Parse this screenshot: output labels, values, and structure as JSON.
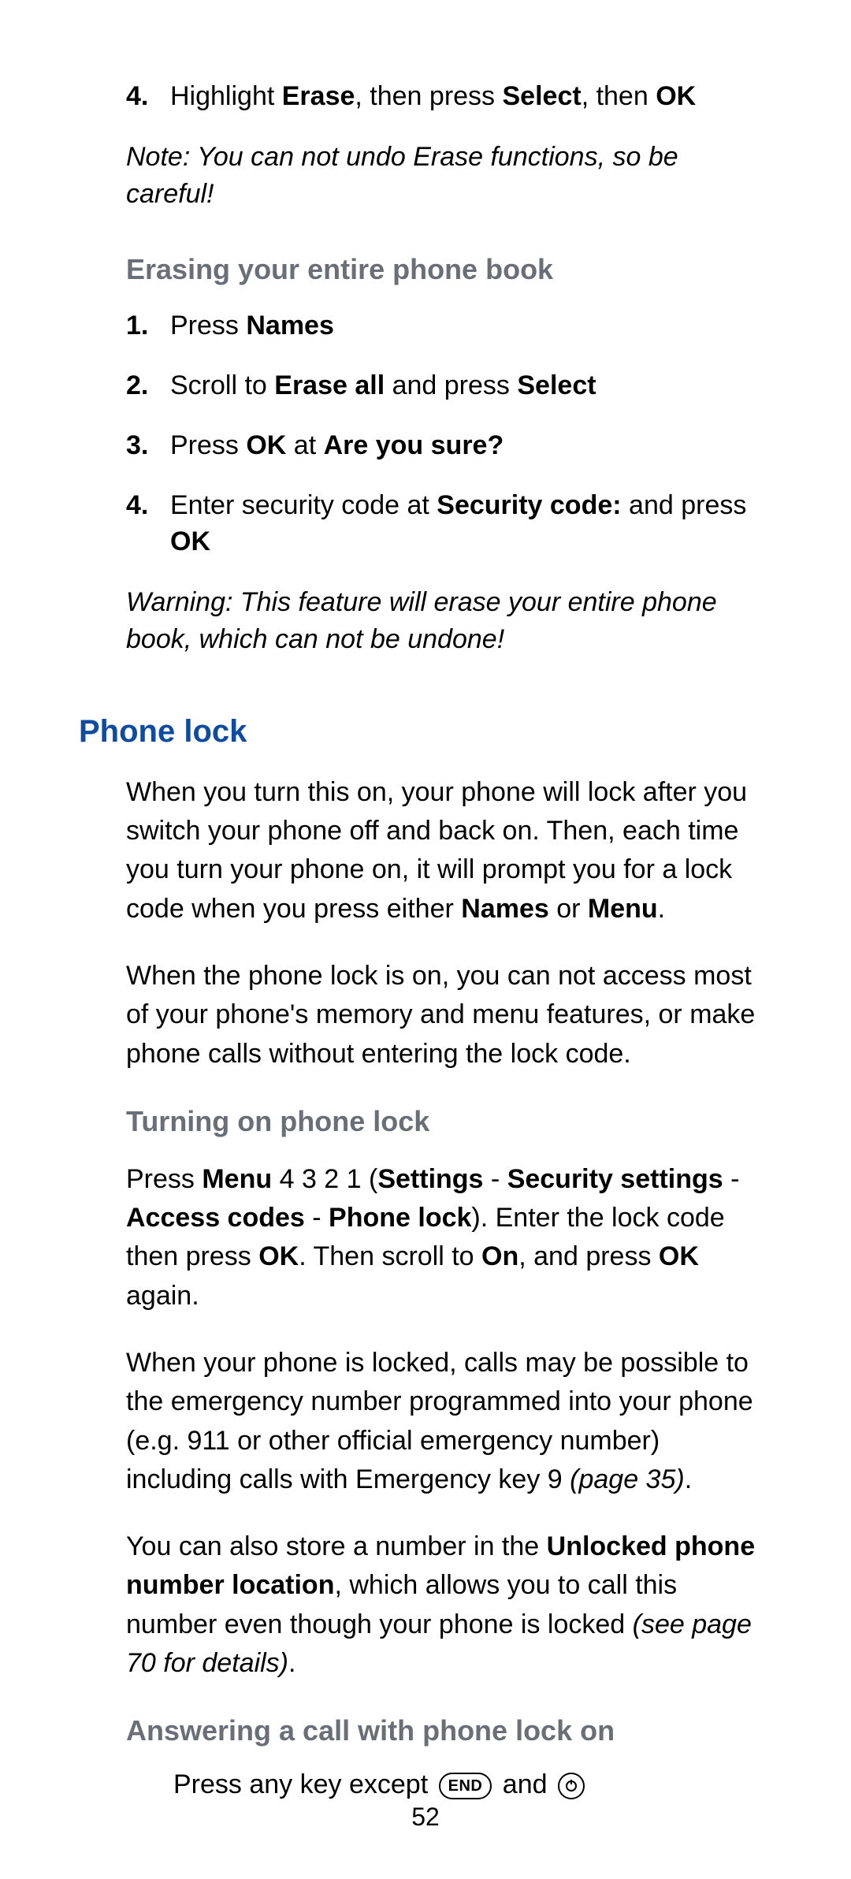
{
  "step4": {
    "num": "4.",
    "t1": "Highlight ",
    "b1": "Erase",
    "t2": ", then press ",
    "b2": "Select",
    "t3": ", then ",
    "b3": "OK"
  },
  "note1": "Note: You can not undo Erase functions, so be careful!",
  "erase": {
    "heading": "Erasing your entire phone book",
    "s1": {
      "num": "1.",
      "t1": "Press ",
      "b1": "Names"
    },
    "s2": {
      "num": "2.",
      "t1": "Scroll to ",
      "b1": "Erase all",
      "t2": " and press ",
      "b2": "Select"
    },
    "s3": {
      "num": "3.",
      "t1": "Press ",
      "b1": "OK",
      "t2": " at ",
      "b2": "Are you sure?"
    },
    "s4": {
      "num": "4.",
      "t1": "Enter security code at ",
      "b1": "Security code:",
      "t2": " and press ",
      "b2": "OK"
    },
    "warning": "Warning: This feature will erase your entire phone book, which can not be undone!"
  },
  "phonelock": {
    "heading": "Phone lock",
    "p1a": "When you turn this on, your phone will lock after you switch your phone off and back on. Then, each time you turn your phone on, it will prompt you for a lock code when you press either ",
    "p1b1": "Names",
    "p1t2": " or ",
    "p1b2": "Menu",
    "p1t3": ".",
    "p2": "When the phone lock is on, you can not access most of your phone's memory and menu features, or make phone calls without entering the lock code."
  },
  "turnon": {
    "heading": "Turning on phone lock",
    "p1": {
      "t1": "Press ",
      "b1": "Menu",
      "t2": " 4 3 2 1 (",
      "b2": "Settings",
      "t3": " - ",
      "b3": "Security settings",
      "t4": " - ",
      "b4": "Access codes",
      "t5": " - ",
      "b5": "Phone lock",
      "t6": "). Enter the lock code then press ",
      "b6": "OK",
      "t7": ". Then scroll to ",
      "b7": "On",
      "t8": ", and press ",
      "b8": "OK",
      "t9": " again."
    },
    "p2": {
      "t1": "When your phone is locked, calls may be possible to the emergency number programmed into your phone (e.g. 911 or other official emergency number) including calls with Emergency key 9 ",
      "ref": "(page 35)",
      "t2": "."
    },
    "p3": {
      "t1": "You can also store a number in the ",
      "b1": "Unlocked phone number location",
      "t2": ", which allows you to call this number even though your phone is locked ",
      "ref": "(see page 70 for details)",
      "t3": "."
    }
  },
  "answer": {
    "heading": "Answering a call with phone lock on",
    "t1": "Press any key except ",
    "key1": "END",
    "t2": " and "
  },
  "pagenum": "52"
}
